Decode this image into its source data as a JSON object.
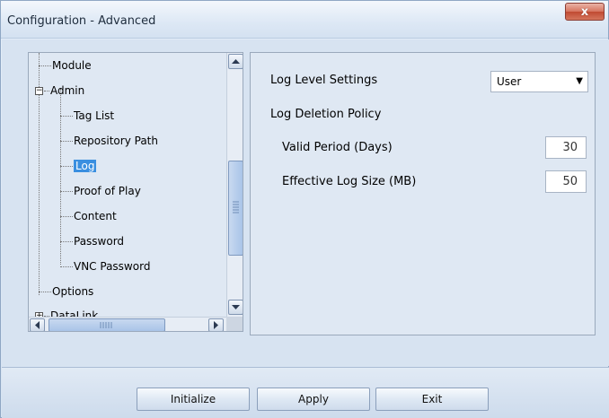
{
  "window": {
    "title": "Configuration - Advanced",
    "close_label": "x"
  },
  "tree": {
    "items": [
      {
        "label": "Module"
      },
      {
        "label": "Admin"
      },
      {
        "label": "Tag List"
      },
      {
        "label": "Repository Path"
      },
      {
        "label": "Log",
        "selected": true
      },
      {
        "label": "Proof of Play"
      },
      {
        "label": "Content"
      },
      {
        "label": "Password"
      },
      {
        "label": "VNC Password"
      },
      {
        "label": "Options"
      },
      {
        "label": "DataLink"
      }
    ]
  },
  "settings": {
    "log_level_label": "Log Level Settings",
    "log_level_value": "User",
    "log_deletion_label": "Log Deletion Policy",
    "valid_period_label": "Valid Period (Days)",
    "valid_period_value": "30",
    "log_size_label": "Effective Log Size (MB)",
    "log_size_value": "50"
  },
  "buttons": {
    "initialize": "Initialize",
    "apply": "Apply",
    "exit": "Exit"
  },
  "icons": {
    "expander": "minus-box-icon",
    "scroll_up": "triangle-up-icon",
    "scroll_down": "triangle-down-icon",
    "scroll_left": "triangle-left-icon",
    "scroll_right": "triangle-right-icon",
    "dropdown": "triangle-down-icon"
  },
  "colors": {
    "selection": "#3a8fe0",
    "close_button": "#c04a32"
  }
}
